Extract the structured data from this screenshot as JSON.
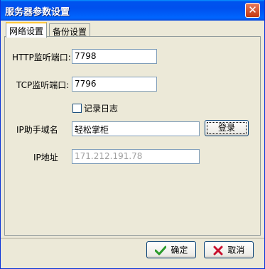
{
  "window": {
    "title": "服务器参数设置",
    "close_label": "✕"
  },
  "tabs": [
    {
      "label": "网络设置",
      "active": true
    },
    {
      "label": "备份设置",
      "active": false
    }
  ],
  "form": {
    "http_port": {
      "label": "HTTP监听端口:",
      "value": "7798"
    },
    "tcp_port": {
      "label": "TCP监听端口:",
      "value": "7796"
    },
    "log": {
      "label": "记录日志",
      "checked": false
    },
    "domain": {
      "label": "IP助手域名",
      "value": "轻松掌柜",
      "button_label": "登录"
    },
    "ip_address": {
      "label": "IP地址",
      "value": "171.212.191.78"
    }
  },
  "buttons": {
    "ok_label": "确定",
    "ok_icon": "check-icon",
    "cancel_label": "取消",
    "cancel_icon": "x-icon"
  },
  "colors": {
    "titlebar": "#0054e3",
    "check": "#2a9a2a",
    "cancel_x": "#c8102e"
  }
}
